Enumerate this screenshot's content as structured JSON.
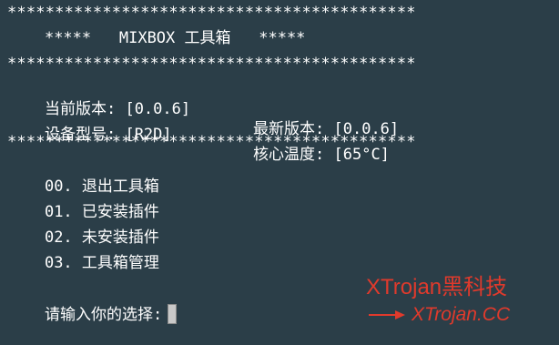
{
  "terminal": {
    "stars_line": "*******************************************",
    "title_stars_left": "*****",
    "title": "MIXBOX 工具箱",
    "title_stars_right": "*****",
    "info": {
      "current_version_label": "当前版本:",
      "current_version_value": "[0.0.6]",
      "latest_version_label": "最新版本:",
      "latest_version_value": "[0.0.6]",
      "device_model_label": "设备型号:",
      "device_model_value": "[R2D]",
      "core_temp_label": "核心温度:",
      "core_temp_value": "[65°C]"
    },
    "menu": [
      {
        "code": "00.",
        "label": "退出工具箱"
      },
      {
        "code": "01.",
        "label": "已安装插件"
      },
      {
        "code": "02.",
        "label": "未安装插件"
      },
      {
        "code": "03.",
        "label": "工具箱管理"
      }
    ],
    "prompt": "请输入你的选择:"
  },
  "watermark": {
    "brand": "XTrojan黑科技",
    "url": "XTrojan.CC",
    "color": "#e03a2c"
  },
  "icons": {
    "arrow": "arrow-right-icon"
  }
}
